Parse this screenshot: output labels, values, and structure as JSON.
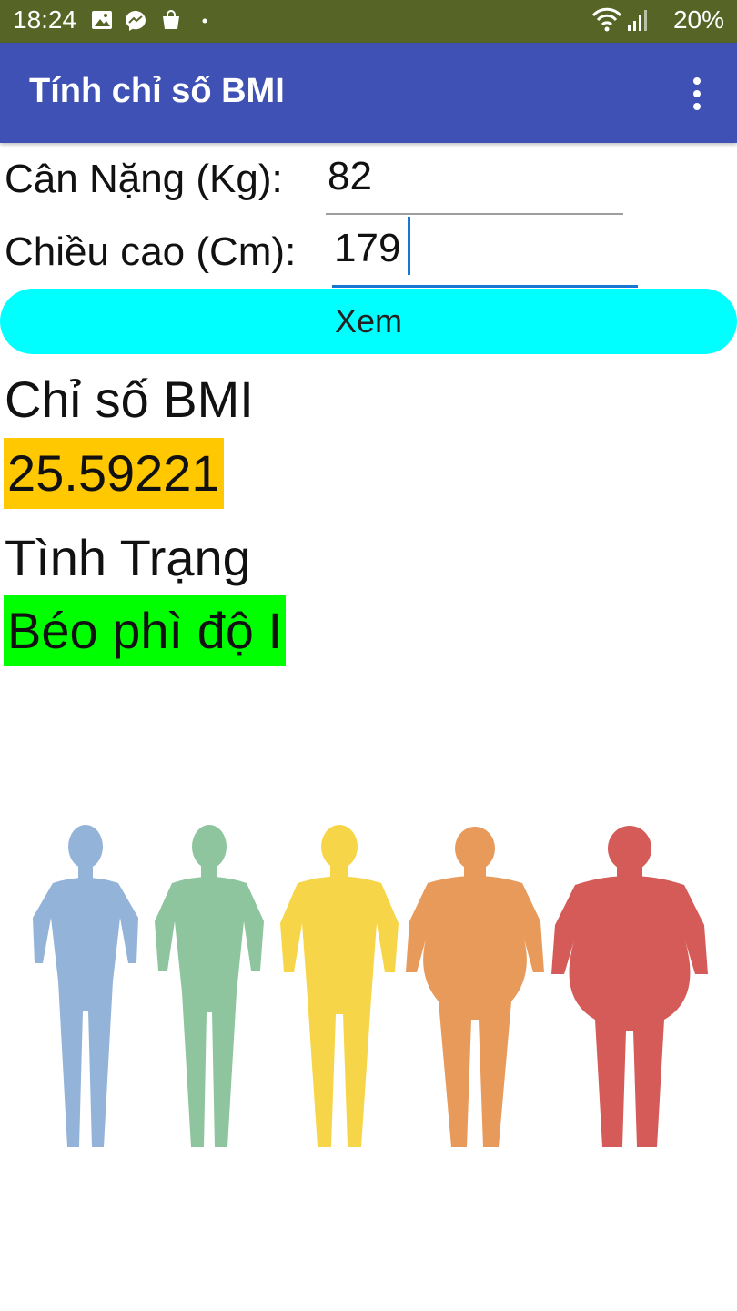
{
  "status_bar": {
    "time": "18:24",
    "battery": "20%",
    "left_icons": [
      "image-icon",
      "messenger-icon",
      "shopping-bag-icon",
      "dot-icon"
    ],
    "right_icons": [
      "wifi-icon",
      "signal-icon"
    ]
  },
  "app_bar": {
    "title": "Tính chỉ số BMI",
    "menu_icon": "more-vert-icon",
    "color": "#3f51b5"
  },
  "form": {
    "weight_label": "Cân Nặng (Kg):",
    "weight_value": "82",
    "height_label": "Chiều cao (Cm):",
    "height_value": "179",
    "submit_label": "Xem",
    "submit_color": "#00ffff"
  },
  "result": {
    "bmi_heading": "Chỉ số BMI",
    "bmi_value": "25.59221",
    "bmi_highlight": "#ffc800",
    "status_heading": "Tình Trạng",
    "status_value": "Béo phì độ I",
    "status_highlight": "#00ff00"
  },
  "illustration": {
    "figures": [
      {
        "name": "underweight-figure",
        "color": "#93b3d8"
      },
      {
        "name": "normal-figure",
        "color": "#8fc59e"
      },
      {
        "name": "overweight-figure",
        "color": "#f7d548"
      },
      {
        "name": "obese-figure",
        "color": "#e89a5b"
      },
      {
        "name": "extremely-obese-figure",
        "color": "#d45b58"
      }
    ]
  }
}
